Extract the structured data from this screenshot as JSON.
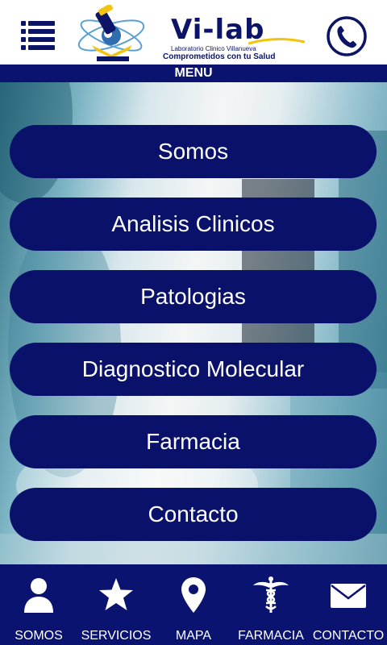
{
  "header": {
    "logo": {
      "title": "Vi-lab",
      "subtitle1": "Laboratorio Clinico Villanueva",
      "subtitle2": "Comprometidos con tu Salud"
    },
    "menu_icon": "hamburger-icon",
    "call_icon": "phone-icon"
  },
  "menu_bar": {
    "label": "MENU"
  },
  "menu": {
    "items": [
      {
        "label": "Somos"
      },
      {
        "label": "Analisis Clinicos"
      },
      {
        "label": "Patologias"
      },
      {
        "label": "Diagnostico Molecular"
      },
      {
        "label": "Farmacia"
      },
      {
        "label": "Contacto"
      }
    ]
  },
  "bottom_nav": {
    "items": [
      {
        "label": "SOMOS",
        "icon": "person-icon"
      },
      {
        "label": "SERVICIOS",
        "icon": "star-icon"
      },
      {
        "label": "MAPA",
        "icon": "map-pin-icon"
      },
      {
        "label": "FARMACIA",
        "icon": "caduceus-icon"
      },
      {
        "label": "CONTACTO",
        "icon": "envelope-icon"
      }
    ]
  },
  "colors": {
    "primary": "#0a1370",
    "button": "#09116b",
    "text_on_primary": "#ffffff"
  }
}
